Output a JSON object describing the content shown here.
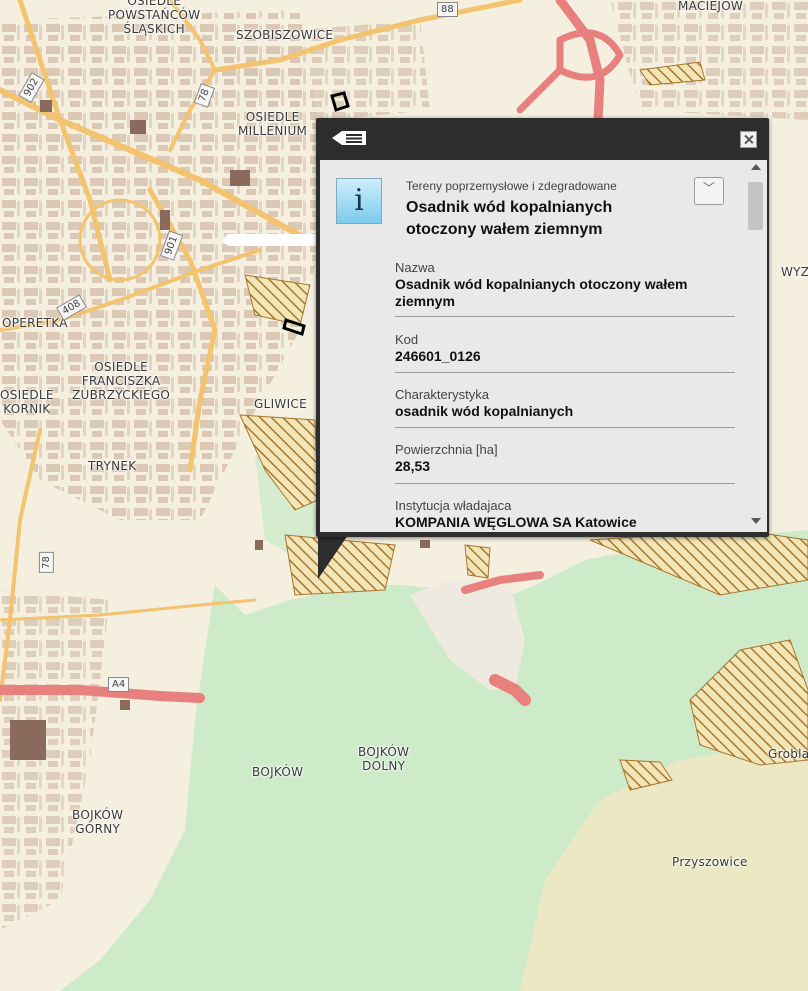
{
  "map": {
    "places": [
      {
        "id": "powstancow",
        "text": "OSIEDLE\nPOWSTAŃCÓW\nŚLĄSKICH"
      },
      {
        "id": "szobiszowice",
        "text": "SZOBISZOWICE"
      },
      {
        "id": "maciejow",
        "text": "MACIEJÓW"
      },
      {
        "id": "milenium",
        "text": "OSIEDLE\nMILLENIUM"
      },
      {
        "id": "operetka",
        "text": "OPERETKA"
      },
      {
        "id": "franciszka",
        "text": "OSIEDLE\nFRANCISZKA\nZUBRZYCKIEGO"
      },
      {
        "id": "kornik",
        "text": "OSIEDLE\nKORNIK"
      },
      {
        "id": "gliwice",
        "text": "GLIWICE"
      },
      {
        "id": "trynek",
        "text": "TRYNEK"
      },
      {
        "id": "wyz",
        "text": "WYZ"
      },
      {
        "id": "bojkow",
        "text": "BOJKÓW"
      },
      {
        "id": "bojkow-dolny",
        "text": "BOJKÓW\nDOLNY"
      },
      {
        "id": "bojkow-gorny",
        "text": "BOJKÓW\nGÓRNY"
      },
      {
        "id": "przyszowice",
        "text": "Przyszowice"
      },
      {
        "id": "grobla",
        "text": "Grobla"
      }
    ],
    "road_numbers": [
      {
        "id": "r88",
        "text": "88"
      },
      {
        "id": "r902",
        "text": "902"
      },
      {
        "id": "r78a",
        "text": "78"
      },
      {
        "id": "r901",
        "text": "901"
      },
      {
        "id": "r408",
        "text": "408"
      },
      {
        "id": "r78b",
        "text": "78"
      },
      {
        "id": "rA4",
        "text": "A4"
      }
    ],
    "colors": {
      "built_area": "#f4efdf",
      "streets": "#d9c6b0",
      "forest": "#cdebc9",
      "field": "#ece8c3",
      "main_road": "#f3c36e",
      "motorway": "#e8807e",
      "hatched_area": "#a8762c"
    }
  },
  "popup": {
    "layer_name": "Tereny poprzemysłowe i zdegradowane",
    "title": "Osadnik wód kopalnianych otoczony wałem ziemnym",
    "info_icon_glyph": "i",
    "toggle_icon": "chevron-down-icon",
    "fields": [
      {
        "label": "Nazwa",
        "value": "Osadnik wód kopalnianych otoczony wałem ziemnym"
      },
      {
        "label": "Kod",
        "value": "246601_0126"
      },
      {
        "label": "Charakterystyka",
        "value": "osadnik wód kopalnianych"
      },
      {
        "label": "Powierzchnia [ha]",
        "value": "28,53"
      },
      {
        "label": "Instytucja władajaca",
        "value": "KOMPANIA WĘGLOWA SA Katowice"
      }
    ]
  }
}
